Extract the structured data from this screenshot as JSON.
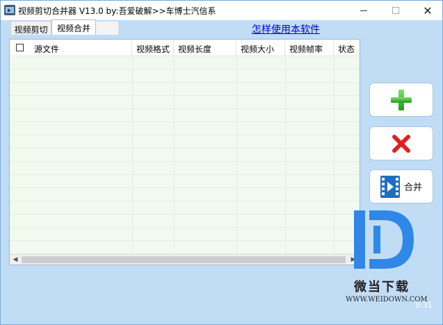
{
  "window": {
    "title": "视频剪切合并器 V13.0 by:吾爱破解>>车博士汽信系",
    "close_symbol": "✕"
  },
  "tabs": [
    {
      "label": "视频剪切",
      "active": false
    },
    {
      "label": "视频合并",
      "active": true
    }
  ],
  "help_link": "怎样使用本软件",
  "table": {
    "columns": [
      "源文件",
      "视频格式",
      "视频长度",
      "视频大小",
      "视频帧率",
      "状态"
    ],
    "rows": []
  },
  "scrollbar": {
    "left_arrow": "◀",
    "right_arrow": "▶"
  },
  "buttons": {
    "add": {
      "icon": "plus-icon",
      "color": "#34b233"
    },
    "remove": {
      "icon": "red-x-icon",
      "color": "#e02020"
    },
    "merge": {
      "icon": "film-icon",
      "label": "合并",
      "color": "#1f6fc1"
    }
  },
  "watermark": {
    "name": "微当下载",
    "url": "WWW.WEIDOWN.COM",
    "corner": "9:31"
  }
}
